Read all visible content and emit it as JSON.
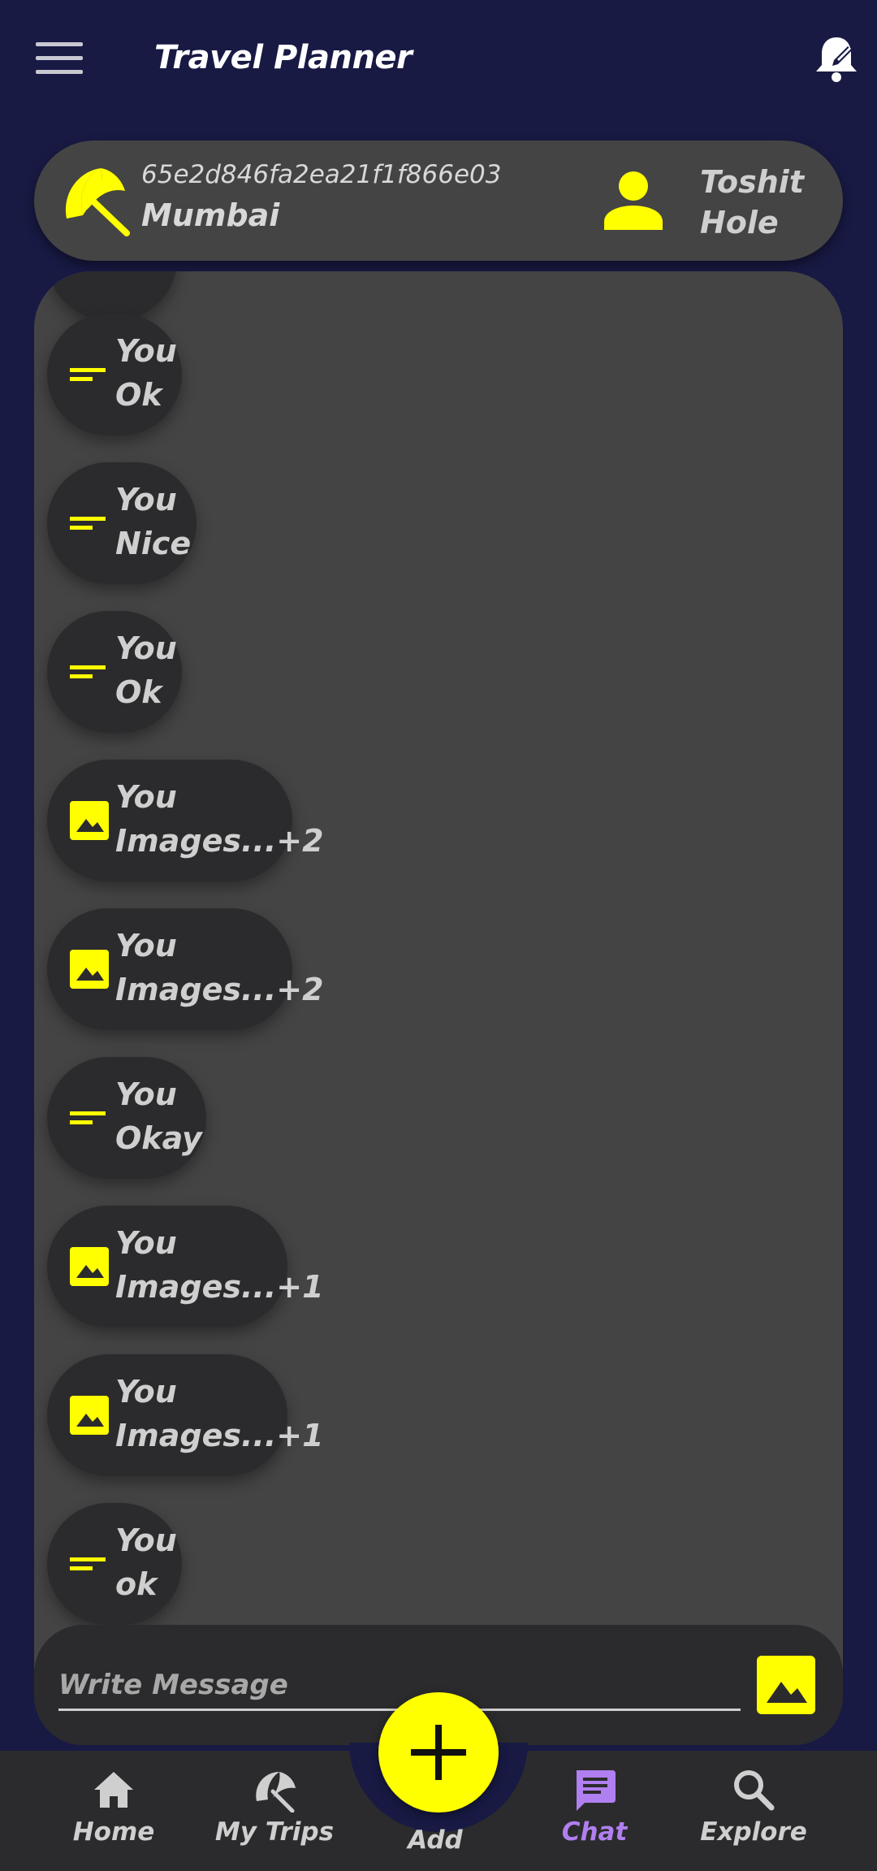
{
  "app": {
    "title": "Travel Planner"
  },
  "trip": {
    "id": "65e2d846fa2ea21f1f866e03",
    "city": "Mumbai",
    "user_first": "Toshit",
    "user_last": "Hole"
  },
  "messages": [
    {
      "sender": "You",
      "text": "Ok",
      "type": "text-icon"
    },
    {
      "sender": "You",
      "text": "Nice",
      "type": "text-icon"
    },
    {
      "sender": "You",
      "text": "Ok",
      "type": "text-icon"
    },
    {
      "sender": "You",
      "text": "Images...+2",
      "type": "image-icon"
    },
    {
      "sender": "You",
      "text": "Images...+2",
      "type": "image-icon"
    },
    {
      "sender": "You",
      "text": "Okay",
      "type": "text-icon"
    },
    {
      "sender": "You",
      "text": "Images...+1",
      "type": "image-icon"
    },
    {
      "sender": "You",
      "text": "Images...+1",
      "type": "image-icon"
    },
    {
      "sender": "You",
      "text": "ok",
      "type": "text-icon"
    }
  ],
  "composer": {
    "placeholder": "Write Message"
  },
  "nav": {
    "home": "Home",
    "trips": "My Trips",
    "add": "Add",
    "chat": "Chat",
    "explore": "Explore"
  },
  "colors": {
    "background": "#181a44",
    "accent": "#ffff00",
    "panel": "#444444",
    "bubble": "#2b2b2d",
    "active_nav": "#b07ff0"
  }
}
